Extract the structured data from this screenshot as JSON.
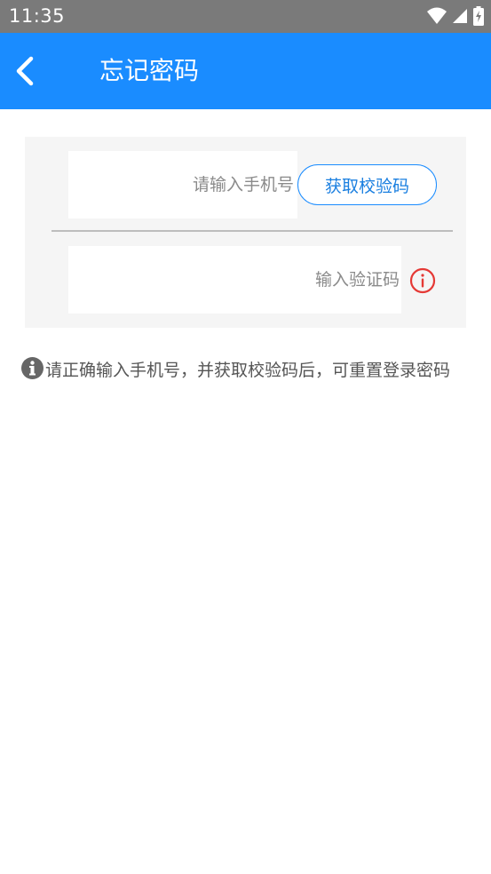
{
  "status_bar": {
    "time": "11:35",
    "icons": [
      "wifi-icon",
      "cell-signal-icon",
      "battery-charging-icon"
    ]
  },
  "app_bar": {
    "back_icon": "chevron-left-icon",
    "title": "忘记密码",
    "color": "#1a8cff"
  },
  "form": {
    "phone": {
      "value": "",
      "placeholder": "请输入手机号"
    },
    "get_code_button": "获取校验码",
    "code": {
      "value": "",
      "placeholder": "输入验证码"
    },
    "error_icon": "alert-circle-icon",
    "error_color": "#e53935"
  },
  "hint": {
    "icon": "info-icon",
    "text": "请正确输入手机号，并获取校验码后，可重置登录密码"
  }
}
